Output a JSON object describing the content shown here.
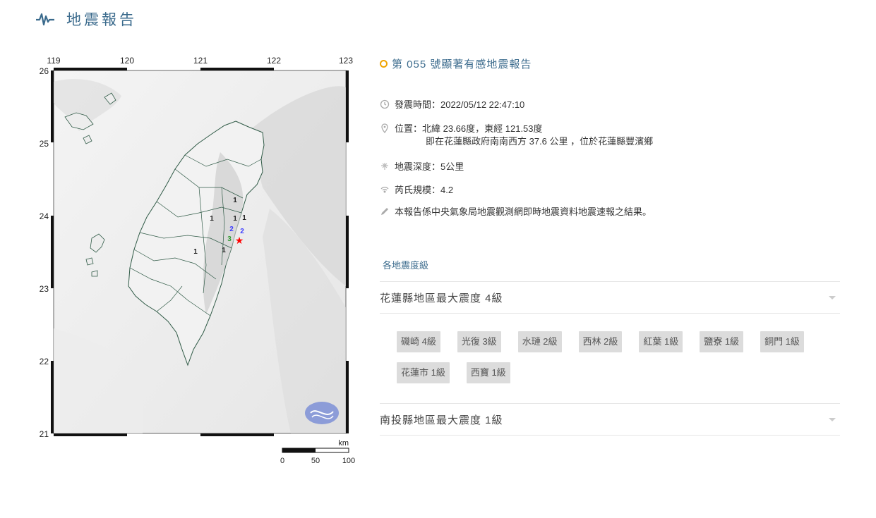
{
  "header": {
    "title": "地震報告"
  },
  "report": {
    "title": "第 055 號顯著有感地震報告",
    "time": "發震時間：2022/05/12 22:47:10",
    "location_line1": "位置：北緯 23.66度，東經 121.53度",
    "location_line2": "即在花蓮縣政府南南西方 37.6 公里 ，位於花蓮縣豐濱鄉",
    "depth": "地震深度：5公里",
    "magnitude": "芮氏規模：4.2",
    "note": "本報告係中央氣象局地震觀測網即時地震資料地震速報之結果。"
  },
  "intensity_section": {
    "title": "各地震度級",
    "regions": [
      {
        "label": "花蓮縣地區最大震度 4級",
        "stations": [
          "磯崎 4級",
          "光復 3級",
          "水璉 2級",
          "西林 2級",
          "紅葉 1級",
          "鹽寮 1級",
          "銅門 1級",
          "花蓮市 1級",
          "西寶 1級"
        ]
      },
      {
        "label": "南投縣地區最大震度 1級",
        "stations": []
      }
    ]
  },
  "map": {
    "lon_ticks": [
      "119",
      "120",
      "121",
      "122",
      "123"
    ],
    "lat_ticks": [
      "26",
      "25",
      "24",
      "23",
      "22",
      "21"
    ],
    "scale_unit": "km",
    "scale_labels": [
      "0",
      "50",
      "100"
    ],
    "intensity_marks": [
      {
        "text": "1",
        "color": "#222222"
      },
      {
        "text": "1",
        "color": "#222222"
      },
      {
        "text": "1",
        "color": "#222222"
      },
      {
        "text": "1",
        "color": "#222222"
      },
      {
        "text": "1",
        "color": "#222222"
      },
      {
        "text": "1",
        "color": "#222222"
      },
      {
        "text": "2",
        "color": "#3a3aff"
      },
      {
        "text": "2",
        "color": "#3a3aff"
      },
      {
        "text": "3",
        "color": "#2e9a2e"
      }
    ],
    "epicenter_color": "#ff0000",
    "accent_color": "#3a6a8c"
  }
}
